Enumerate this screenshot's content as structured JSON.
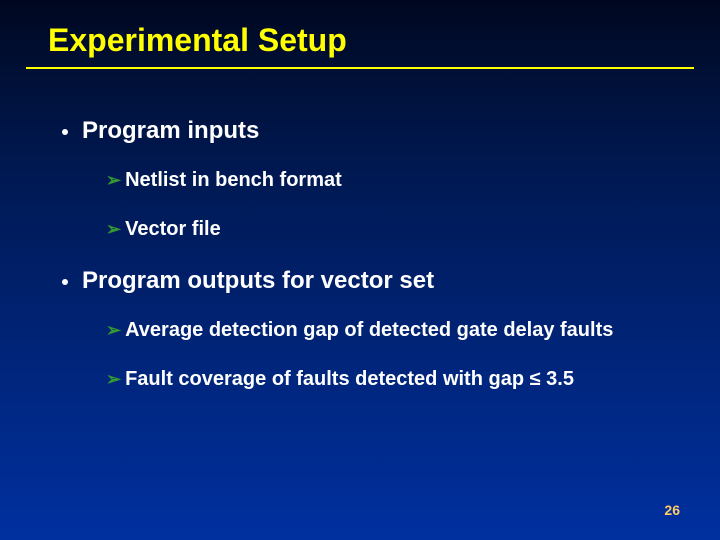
{
  "title": "Experimental Setup",
  "sections": [
    {
      "heading": "Program inputs",
      "items": [
        "Netlist in bench format",
        "Vector file"
      ]
    },
    {
      "heading": "Program outputs for vector set",
      "items": [
        "Average detection gap of detected gate delay faults",
        "Fault coverage of faults detected with gap ≤ 3.5"
      ]
    }
  ],
  "page_number": "26"
}
